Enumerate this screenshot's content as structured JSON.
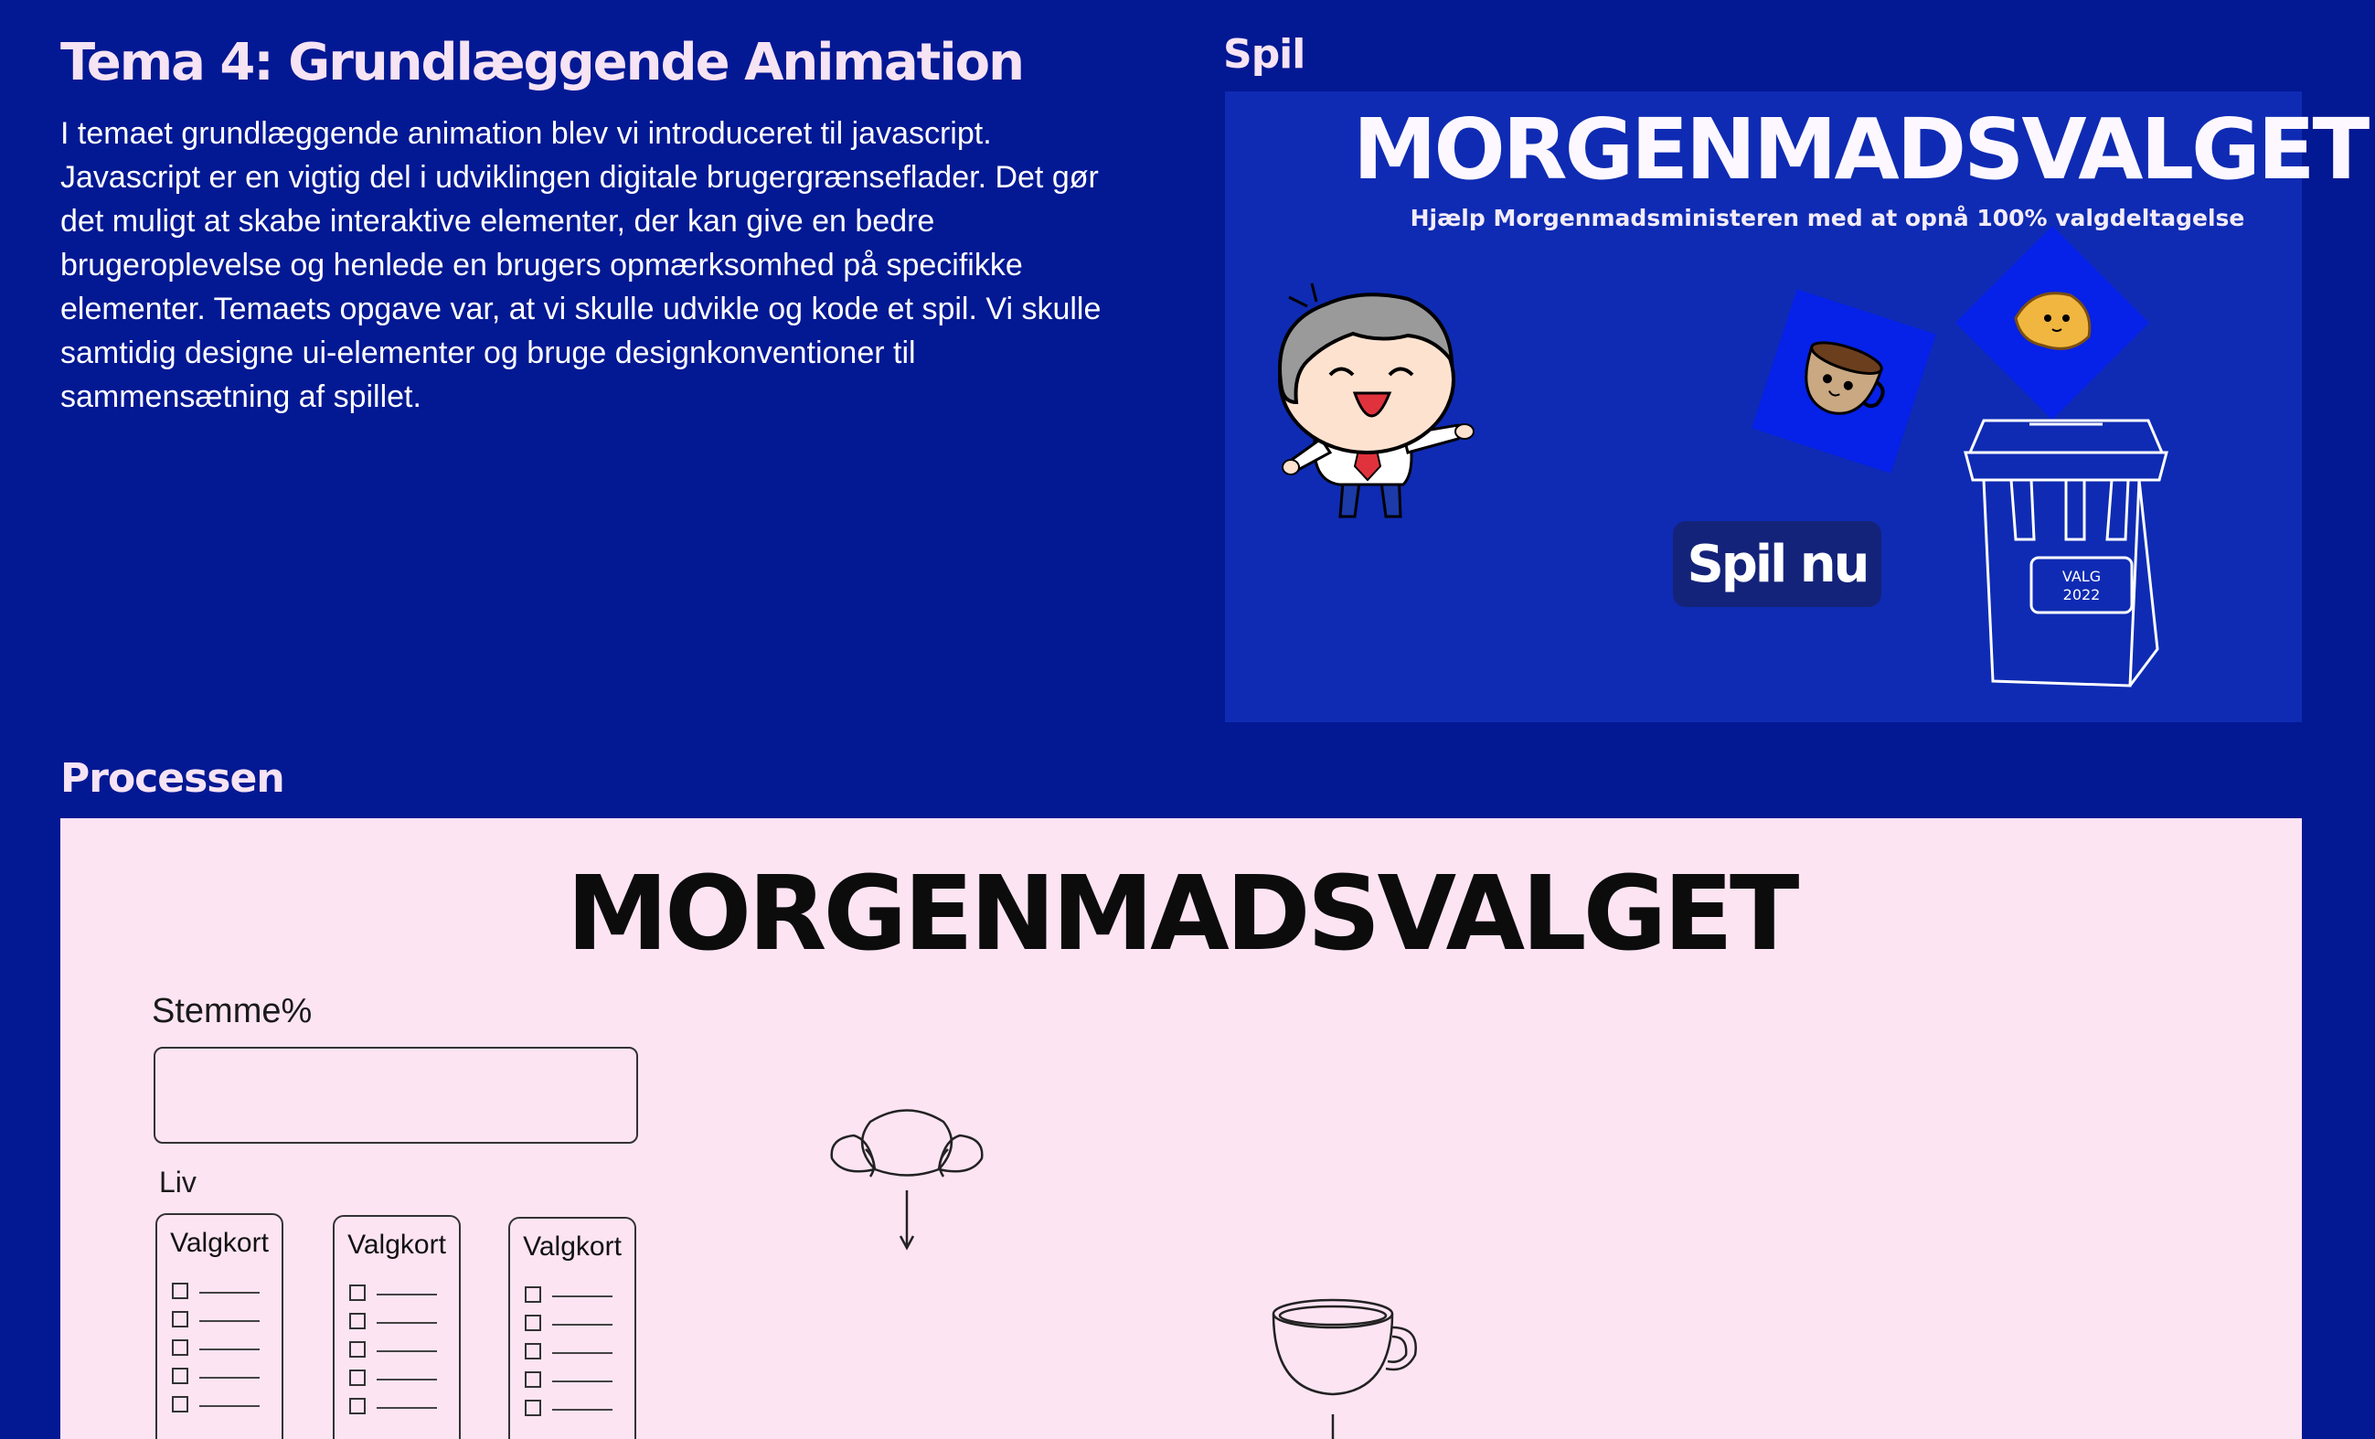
{
  "header": {
    "title": "Tema 4: Grundlæggende Animation",
    "intro": "I temaet grundlæggende animation blev vi introduceret til javascript. Javascript er en vigtig del i udviklingen digitale brugergrænseflader. Det gør det muligt at skabe interaktive elementer, der kan give en bedre brugeroplevelse og henlede en brugers opmærksomhed på specifikke elementer. Temaets opgave var, at vi skulle udvikle og kode et spil. Vi skulle samtidig designe ui-elementer og bruge designkonventioner til sammensætning af spillet."
  },
  "game": {
    "heading": "Spil",
    "title": "MORGENMADSVALGET",
    "subtitle": "Hjælp Morgenmadsministeren med at opnå 100% valgdeltagelse",
    "play_button": "Spil nu",
    "ballot_box_text_line1": "VALG",
    "ballot_box_text_line2": "2022",
    "icons": [
      "minister-character",
      "coffee-cup-icon",
      "croissant-icon",
      "ballot-box-icon"
    ]
  },
  "process": {
    "heading": "Processen",
    "title": "MORGENMADSVALGET",
    "stemme_label": "Stemme%",
    "liv_label": "Liv",
    "cards": [
      {
        "title": "Valgkort"
      },
      {
        "title": "Valgkort"
      },
      {
        "title": "Valgkort"
      }
    ]
  },
  "colors": {
    "background": "#031893",
    "heading": "#f6e3f3",
    "game_background": "#0f2bb3",
    "tile": "#0621e8",
    "button": "#14237a",
    "panel": "#fde4f3"
  }
}
